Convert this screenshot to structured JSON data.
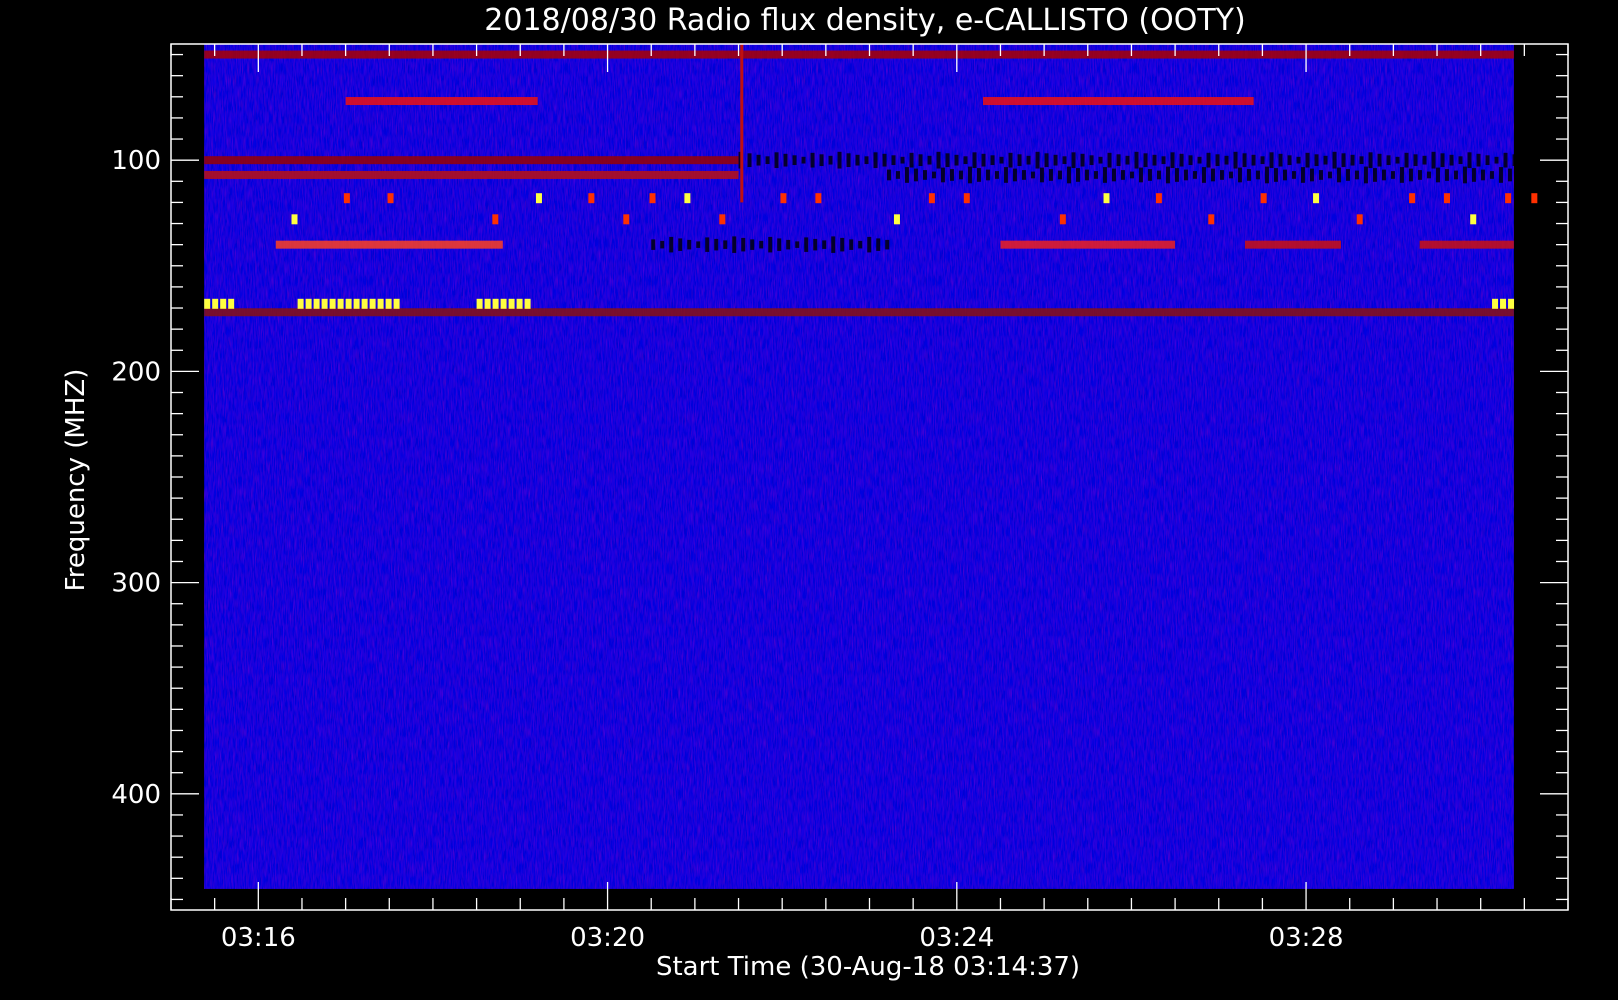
{
  "chart_data": {
    "type": "heatmap",
    "title": "2018/08/30  Radio flux density, e-CALLISTO (OOTY)",
    "xlabel": "Start Time (30-Aug-18 03:14:37)",
    "ylabel": "Frequency (MHZ)",
    "x_ticks": [
      "03:16",
      "03:20",
      "03:24",
      "03:28"
    ],
    "y_ticks": [
      100,
      200,
      300,
      400
    ],
    "ylim": [
      45,
      455
    ],
    "y_inverted": true,
    "xlim_minutes": [
      0,
      16
    ],
    "data_range_minutes": [
      0.38,
      15.38
    ],
    "data_freq_range_mhz": [
      45,
      445
    ],
    "colors": {
      "background": "#0000e6",
      "low": "#000000",
      "mid": "#c01010",
      "high": "#ff3000",
      "peak": "#ffff40"
    },
    "bands": [
      {
        "freq": 50,
        "t": [
          0.38,
          15.38
        ],
        "color": "#aa0000"
      },
      {
        "freq": 72,
        "t": [
          2.0,
          4.2
        ],
        "color": "#ee1111"
      },
      {
        "freq": 72,
        "t": [
          9.3,
          12.4
        ],
        "color": "#ee1111"
      },
      {
        "freq": 100,
        "t": [
          0.38,
          6.5
        ],
        "color": "#990000"
      },
      {
        "freq": 107,
        "t": [
          0.38,
          6.5
        ],
        "color": "#bb1010"
      },
      {
        "freq": 140,
        "t": [
          1.2,
          3.8
        ],
        "color": "#ff4020"
      },
      {
        "freq": 140,
        "t": [
          9.5,
          11.5
        ],
        "color": "#ee2020"
      },
      {
        "freq": 140,
        "t": [
          12.3,
          13.4
        ],
        "color": "#cc1010"
      },
      {
        "freq": 140,
        "t": [
          14.3,
          15.38
        ],
        "color": "#cc1010"
      },
      {
        "freq": 172,
        "t": [
          0.38,
          15.38
        ],
        "color": "#881010"
      }
    ],
    "dark_bands": [
      {
        "freq": 100,
        "t": [
          6.5,
          15.38
        ]
      },
      {
        "freq": 107,
        "t": [
          8.2,
          15.38
        ]
      },
      {
        "freq": 140,
        "t": [
          5.5,
          8.2
        ]
      }
    ],
    "bursts": [
      {
        "freq": 168,
        "t": [
          0.38,
          0.7
        ]
      },
      {
        "freq": 168,
        "t": [
          1.45,
          2.6
        ]
      },
      {
        "freq": 168,
        "t": [
          3.5,
          4.1
        ]
      },
      {
        "freq": 168,
        "t": [
          15.13,
          15.38
        ]
      }
    ],
    "spike_time": 6.52
  }
}
